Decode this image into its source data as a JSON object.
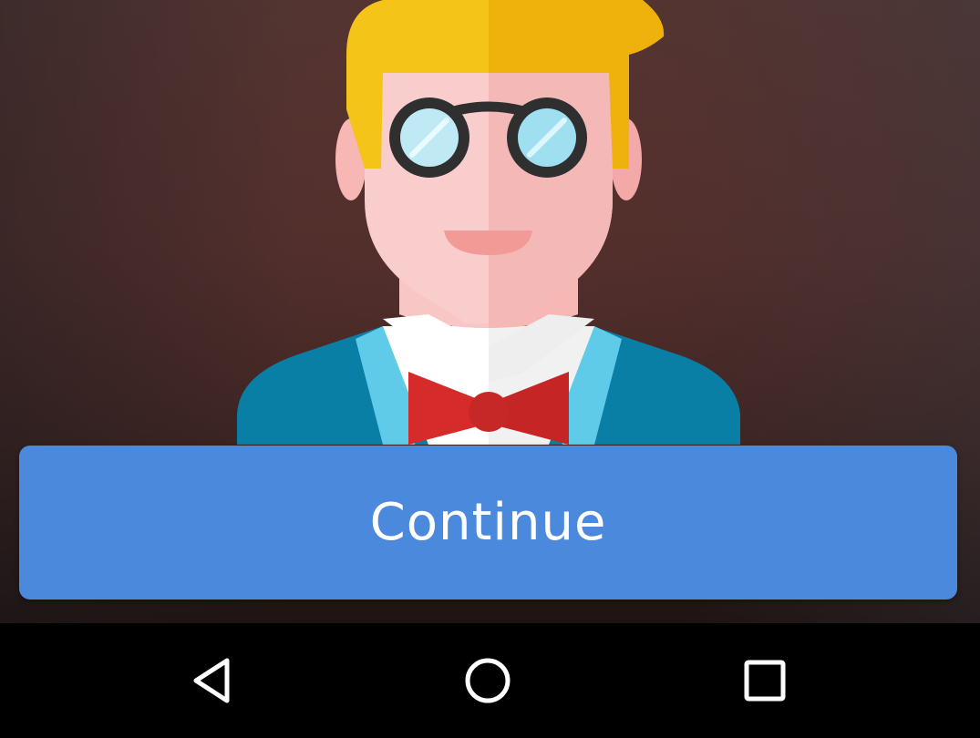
{
  "main": {
    "continue_label": "Continue",
    "avatar_icon": "nerd-avatar-illustration"
  },
  "navigation_bar": {
    "back_icon": "back-triangle-icon",
    "home_icon": "home-circle-icon",
    "recents_icon": "recents-square-icon"
  },
  "colors": {
    "button": "#4a89dc",
    "button_text": "#ffffff",
    "nav_background": "#000000",
    "nav_icons": "#ffffff",
    "background": "#4a2e2c"
  }
}
